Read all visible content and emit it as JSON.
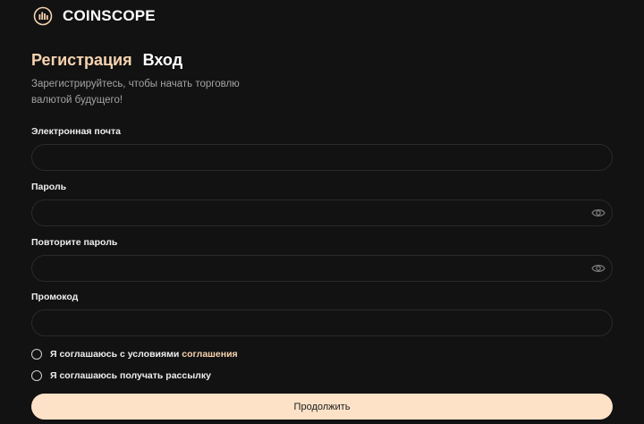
{
  "brand": {
    "name": "COINSCOPE",
    "icon": "bar-chart-circle-icon",
    "accent": "#f7d3b0"
  },
  "tabs": [
    {
      "label": "Регистрация",
      "active": true
    },
    {
      "label": "Вход",
      "active": false
    }
  ],
  "subtitle": "Зарегистрируйтесь, чтобы начать торговлю валютой будущего!",
  "fields": {
    "email": {
      "label": "Электронная почта",
      "value": ""
    },
    "password": {
      "label": "Пароль",
      "value": "",
      "icon": "eye-icon"
    },
    "password_repeat": {
      "label": "Повторите пароль",
      "value": "",
      "icon": "eye-icon"
    },
    "promo": {
      "label": "Промокод",
      "value": ""
    }
  },
  "agreements": {
    "terms_text": "Я соглашаюсь с условиями ",
    "terms_link": "соглашения",
    "newsletter_text": "Я соглашаюсь получать рассылку"
  },
  "submit_label": "Продолжить",
  "colors": {
    "background": "#121212",
    "button": "#fde2c8",
    "border": "#2a2a2a"
  }
}
